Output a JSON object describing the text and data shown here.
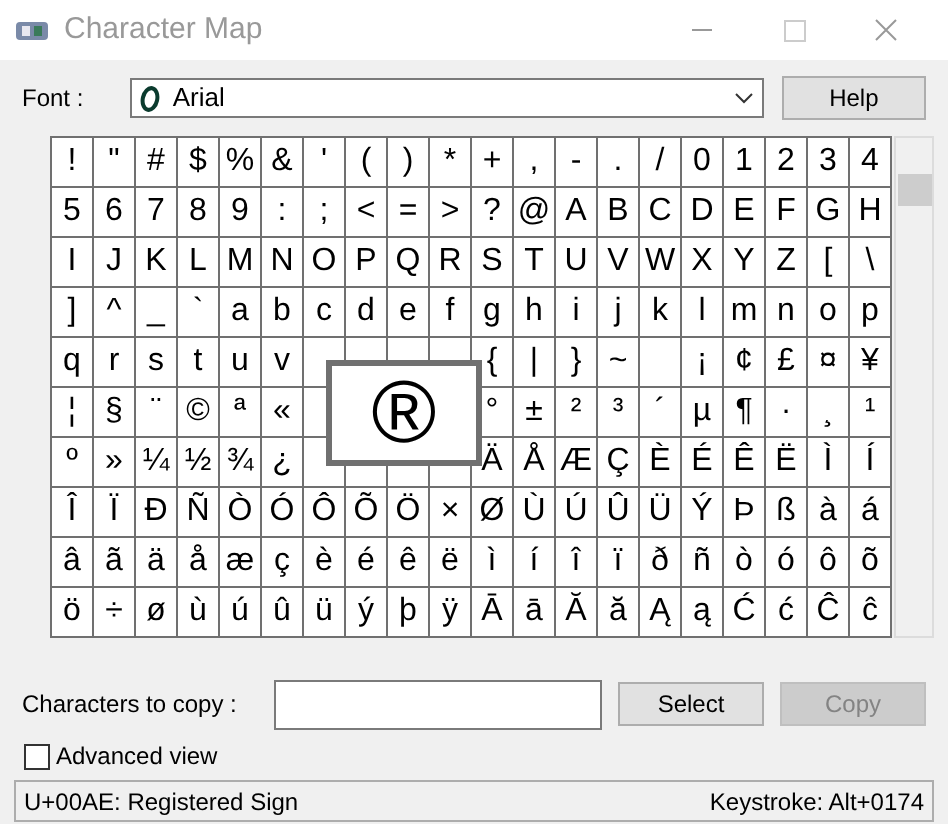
{
  "window": {
    "title": "Character Map"
  },
  "font": {
    "label": "Font :",
    "value": "Arial",
    "help": "Help"
  },
  "grid": [
    [
      "!",
      "\"",
      "#",
      "$",
      "%",
      "&",
      "'",
      "(",
      ")",
      "*",
      "+",
      ",",
      "-",
      ".",
      "/",
      "0",
      "1",
      "2",
      "3",
      "4"
    ],
    [
      "5",
      "6",
      "7",
      "8",
      "9",
      ":",
      ";",
      "<",
      "=",
      ">",
      "?",
      "@",
      "A",
      "B",
      "C",
      "D",
      "E",
      "F",
      "G",
      "H"
    ],
    [
      "I",
      "J",
      "K",
      "L",
      "M",
      "N",
      "O",
      "P",
      "Q",
      "R",
      "S",
      "T",
      "U",
      "V",
      "W",
      "X",
      "Y",
      "Z",
      "[",
      "\\"
    ],
    [
      "]",
      "^",
      "_",
      "`",
      "a",
      "b",
      "c",
      "d",
      "e",
      "f",
      "g",
      "h",
      "i",
      "j",
      "k",
      "l",
      "m",
      "n",
      "o",
      "p"
    ],
    [
      "q",
      "r",
      "s",
      "t",
      "u",
      "v",
      {
        "kind": "blank"
      },
      {
        "kind": "blank"
      },
      {
        "kind": "blank"
      },
      {
        "kind": "blank"
      },
      "{",
      "|",
      "}",
      "~",
      {
        "kind": "blank"
      },
      "¡",
      "¢",
      "£",
      "¤",
      "¥"
    ],
    [
      "¦",
      "§",
      "¨",
      "©",
      "ª",
      "«",
      {
        "kind": "blank"
      },
      {
        "kind": "blank"
      },
      {
        "kind": "blank"
      },
      {
        "kind": "blank"
      },
      "°",
      "±",
      "²",
      "³",
      "´",
      "µ",
      "¶",
      "·",
      "¸",
      "¹"
    ],
    [
      "º",
      "»",
      "¼",
      "½",
      "¾",
      "¿",
      {
        "kind": "blank"
      },
      {
        "kind": "blank"
      },
      {
        "kind": "blank"
      },
      {
        "kind": "blank"
      },
      "Ä",
      "Å",
      "Æ",
      "Ç",
      "È",
      "É",
      "Ê",
      "Ë",
      "Ì",
      "Í"
    ],
    [
      "Î",
      "Ï",
      "Ð",
      "Ñ",
      "Ò",
      "Ó",
      "Ô",
      "Õ",
      "Ö",
      "×",
      "Ø",
      "Ù",
      "Ú",
      "Û",
      "Ü",
      "Ý",
      "Þ",
      "ß",
      "à",
      "á"
    ],
    [
      "â",
      "ã",
      "ä",
      "å",
      "æ",
      "ç",
      "è",
      "é",
      "ê",
      "ë",
      "ì",
      "í",
      "î",
      "ï",
      "ð",
      "ñ",
      "ò",
      "ó",
      "ô",
      "õ"
    ],
    [
      "ö",
      "÷",
      "ø",
      "ù",
      "ú",
      "û",
      "ü",
      "ý",
      "þ",
      "ÿ",
      "Ā",
      "ā",
      "Ă",
      "ă",
      "Ą",
      "ą",
      "Ć",
      "ć",
      "Ĉ",
      "ĉ"
    ]
  ],
  "magnified": "®",
  "copy": {
    "label": "Characters to copy :",
    "select": "Select",
    "copy": "Copy",
    "copy_disabled": true
  },
  "advanced_view": {
    "label": "Advanced view",
    "checked": false
  },
  "status_bar": {
    "description": "U+00AE: Registered Sign",
    "keystroke": "Keystroke: Alt+0174"
  }
}
